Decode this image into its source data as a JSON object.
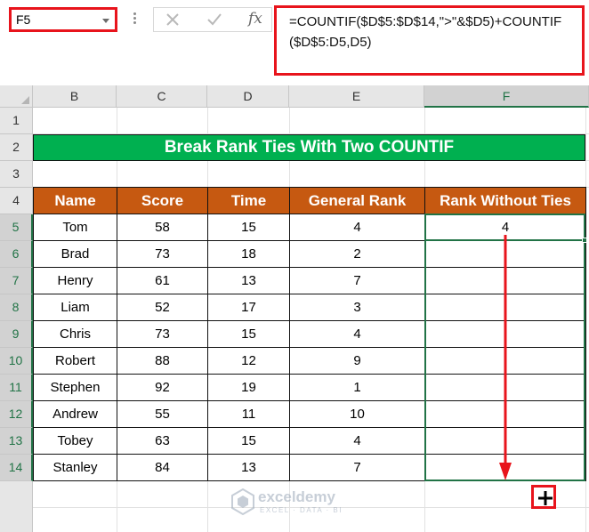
{
  "name_box": {
    "value": "F5"
  },
  "formula_bar": {
    "fx_label": "fx",
    "formula": "=COUNTIF($D$5:$D$14,\">\"&$D5)+COUNTIF($D$5:D5,D5)"
  },
  "columns": [
    "B",
    "C",
    "D",
    "E",
    "F"
  ],
  "rows": [
    "1",
    "2",
    "3",
    "4",
    "5",
    "6",
    "7",
    "8",
    "9",
    "10",
    "11",
    "12",
    "13",
    "14"
  ],
  "title": "Break Rank Ties With Two COUNTIF",
  "table": {
    "headers": [
      "Name",
      "Score",
      "Time",
      "General Rank",
      "Rank Without Ties"
    ],
    "rows": [
      [
        "Tom",
        "58",
        "15",
        "4",
        "4"
      ],
      [
        "Brad",
        "73",
        "18",
        "2",
        ""
      ],
      [
        "Henry",
        "61",
        "13",
        "7",
        ""
      ],
      [
        "Liam",
        "52",
        "17",
        "3",
        ""
      ],
      [
        "Chris",
        "73",
        "15",
        "4",
        ""
      ],
      [
        "Robert",
        "88",
        "12",
        "9",
        ""
      ],
      [
        "Stephen",
        "92",
        "19",
        "1",
        ""
      ],
      [
        "Andrew",
        "55",
        "11",
        "10",
        ""
      ],
      [
        "Tobey",
        "63",
        "15",
        "4",
        ""
      ],
      [
        "Stanley",
        "84",
        "13",
        "7",
        ""
      ]
    ]
  },
  "watermark": {
    "name": "exceldemy",
    "tagline": "EXCEL · DATA · BI"
  },
  "colors": {
    "title_bg": "#00b050",
    "header_bg": "#c65911",
    "highlight": "#e8141c",
    "selection": "#217346"
  }
}
